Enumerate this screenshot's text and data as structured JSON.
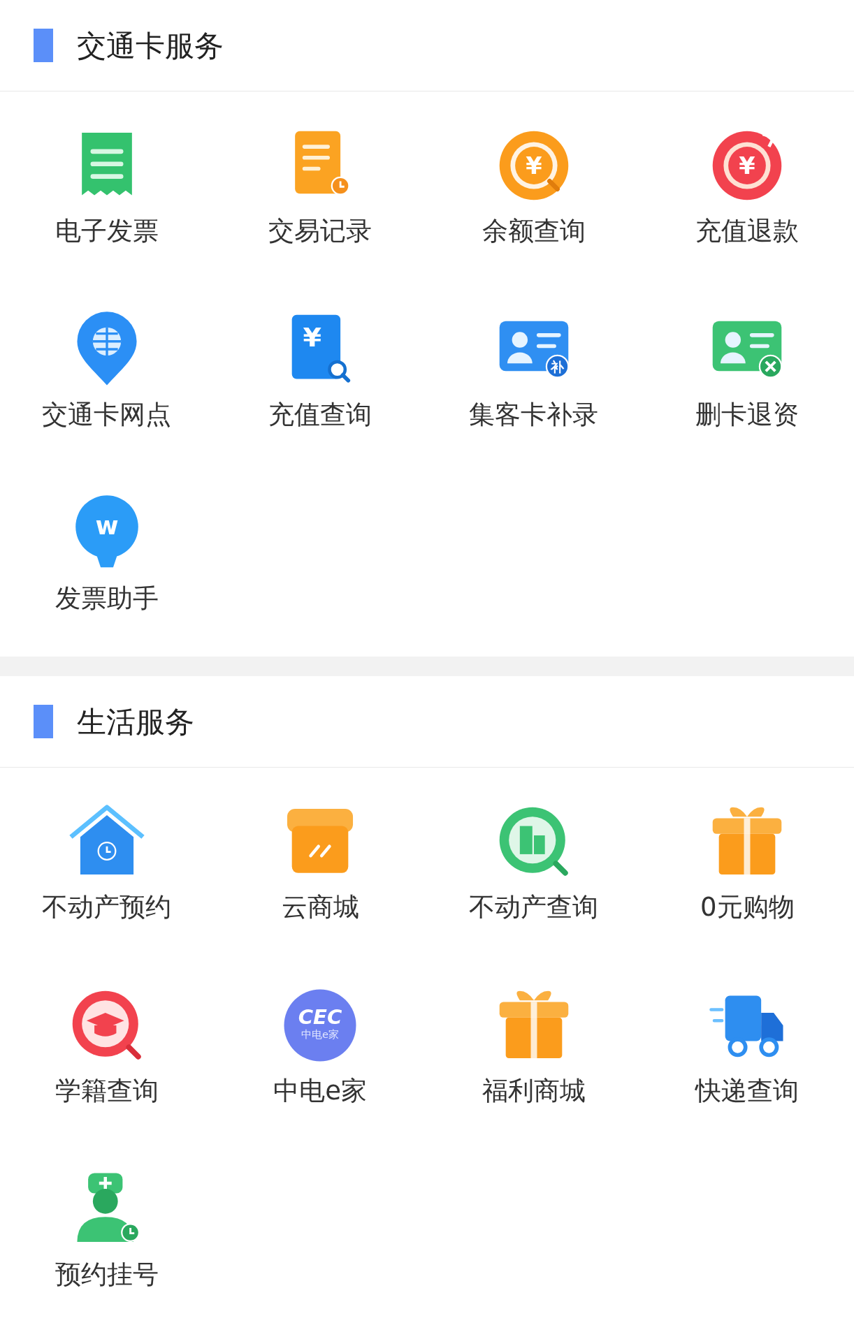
{
  "sections": [
    {
      "title": "交通卡服务",
      "items": [
        {
          "label": "电子发票",
          "kind": "receipt"
        },
        {
          "label": "交易记录",
          "kind": "doc-clock"
        },
        {
          "label": "余额查询",
          "kind": "coin-search",
          "glyph": "¥"
        },
        {
          "label": "充值退款",
          "kind": "coin-refund",
          "glyph": "¥"
        },
        {
          "label": "交通卡网点",
          "kind": "pin-globe"
        },
        {
          "label": "充值查询",
          "kind": "doc-search",
          "glyph": "¥"
        },
        {
          "label": "集客卡补录",
          "kind": "card-plus",
          "glyph": "补"
        },
        {
          "label": "删卡退资",
          "kind": "card-remove"
        },
        {
          "label": "发票助手",
          "kind": "bulb",
          "glyph": "w"
        }
      ]
    },
    {
      "title": "生活服务",
      "items": [
        {
          "label": "不动产预约",
          "kind": "house-clock"
        },
        {
          "label": "云商城",
          "kind": "shop"
        },
        {
          "label": "不动产查询",
          "kind": "building-search"
        },
        {
          "label": "0元购物",
          "kind": "gift"
        },
        {
          "label": "学籍查询",
          "kind": "cap-search"
        },
        {
          "label": "中电e家",
          "kind": "logo",
          "glyph": "CEC",
          "subglyph": "中电e家"
        },
        {
          "label": "福利商城",
          "kind": "gift"
        },
        {
          "label": "快递查询",
          "kind": "truck"
        },
        {
          "label": "预约挂号",
          "kind": "doctor-clock"
        }
      ]
    }
  ]
}
